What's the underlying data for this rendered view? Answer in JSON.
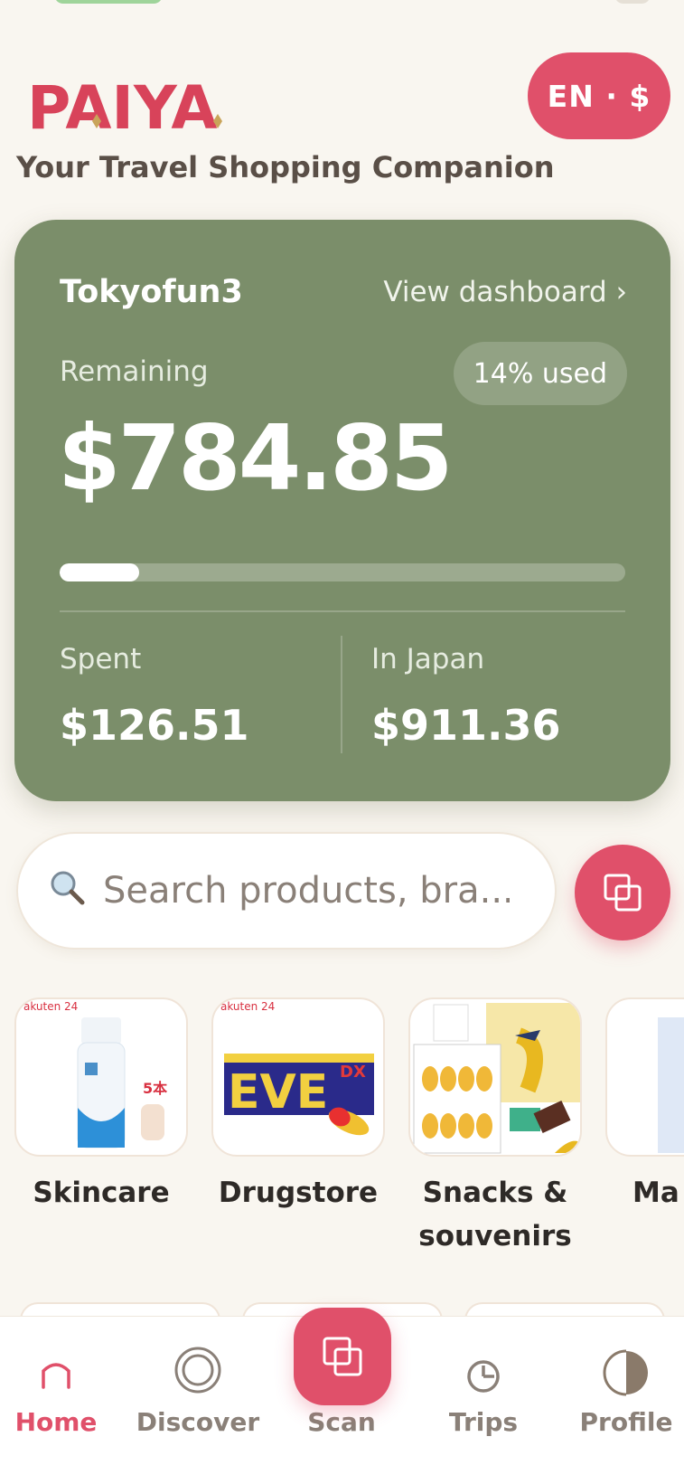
{
  "app": {
    "logo_text": "PAIYA",
    "tagline": "Your Travel Shopping Companion",
    "lang_currency": "EN · $"
  },
  "budget": {
    "username": "Tokyofun3",
    "dashboard_link": "View dashboard ›",
    "remaining_label": "Remaining",
    "used_badge": "14% used",
    "used_fraction": 0.14,
    "remaining_amount": "$784.85",
    "spent_label": "Spent",
    "spent_amount": "$126.51",
    "in_japan_label": "In Japan",
    "in_japan_amount": "$911.36"
  },
  "search": {
    "placeholder": "Search products, bra..."
  },
  "categories": [
    {
      "label": "Skincare"
    },
    {
      "label": "Drugstore"
    },
    {
      "label": "Snacks & souvenirs"
    },
    {
      "label": "Ma"
    }
  ],
  "bottom_nav": {
    "items": [
      {
        "label": "Home",
        "icon": "home-icon",
        "active": true
      },
      {
        "label": "Discover",
        "icon": "discover-icon",
        "active": false
      },
      {
        "label": "Scan",
        "icon": "scan-icon",
        "active": false
      },
      {
        "label": "Trips",
        "icon": "trips-icon",
        "active": false
      },
      {
        "label": "Profile",
        "icon": "profile-icon",
        "active": false
      }
    ]
  },
  "colors": {
    "accent": "#e0506a",
    "card_green": "#7b8e6a",
    "background": "#f9f6f0"
  }
}
